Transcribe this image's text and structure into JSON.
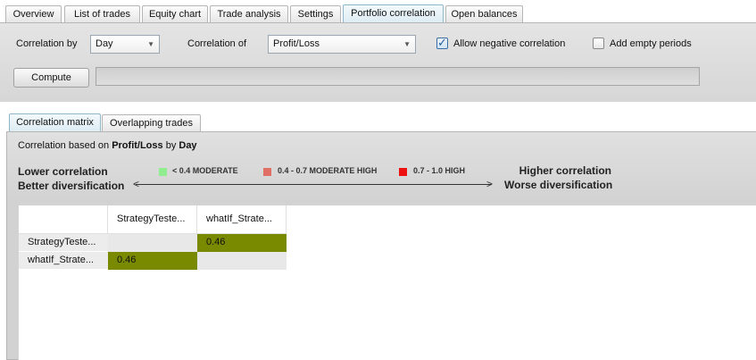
{
  "tabs": [
    {
      "label": "Overview",
      "active": false
    },
    {
      "label": "List of trades",
      "active": false
    },
    {
      "label": "Equity chart",
      "active": false
    },
    {
      "label": "Trade analysis",
      "active": false
    },
    {
      "label": "Settings",
      "active": false
    },
    {
      "label": "Portfolio correlation",
      "active": true
    },
    {
      "label": "Open balances",
      "active": false
    }
  ],
  "settings": {
    "correlation_by_label": "Correlation by",
    "correlation_by_value": "Day",
    "correlation_of_label": "Correlation of",
    "correlation_of_value": "Profit/Loss",
    "allow_negative_label": "Allow negative correlation",
    "allow_negative_checked": true,
    "add_empty_label": "Add empty periods",
    "add_empty_checked": false,
    "compute_label": "Compute",
    "progress": 0
  },
  "subtabs": [
    {
      "label": "Correlation matrix",
      "active": true
    },
    {
      "label": "Overlapping trades",
      "active": false
    }
  ],
  "info": {
    "prefix": "Correlation based on ",
    "metric": "Profit/Loss",
    "by": " by ",
    "period": "Day"
  },
  "legend": {
    "lower_line1": "Lower correlation",
    "lower_line2": "Better diversification",
    "higher_line1": "Higher correlation",
    "higher_line2": "Worse diversification",
    "items": [
      {
        "label": "< 0.4 MODERATE",
        "color": "#90ee90"
      },
      {
        "label": "0.4 - 0.7 MODERATE HIGH",
        "color": "#e07065"
      },
      {
        "label": "0.7 - 1.0 HIGH",
        "color": "#ee1111"
      }
    ]
  },
  "matrix": {
    "columns": [
      "StrategyTeste...",
      "whatIf_Strate..."
    ],
    "rows": [
      {
        "name": "StrategyTeste...",
        "values": [
          "",
          "0.46"
        ]
      },
      {
        "name": "whatIf_Strate...",
        "values": [
          "0.46",
          ""
        ]
      }
    ],
    "value_color": "#7a8a00"
  }
}
